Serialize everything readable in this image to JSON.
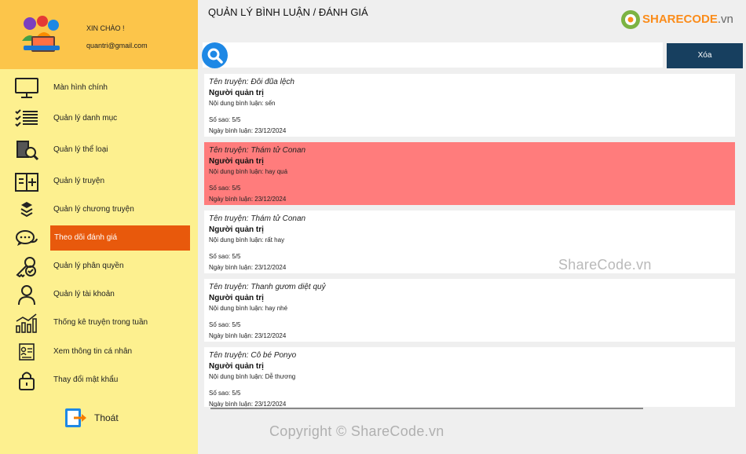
{
  "sidebar": {
    "greeting": "XIN CHÀO !",
    "email": "quantri@gmail.com",
    "items": [
      {
        "label": "Màn hình chính",
        "icon": "monitor-icon"
      },
      {
        "label": "Quản lý danh mục",
        "icon": "checklist-icon"
      },
      {
        "label": "Quản lý thể loại",
        "icon": "book-search-icon"
      },
      {
        "label": "Quản lý truyện",
        "icon": "book-add-icon"
      },
      {
        "label": "Quản lý chương truyện",
        "icon": "layers-icon"
      },
      {
        "label": "Theo dõi đánh giá",
        "icon": "chat-icon",
        "active": true
      },
      {
        "label": "Quản lý phân quyền",
        "icon": "key-user-icon"
      },
      {
        "label": "Quản lý tài khoản",
        "icon": "user-icon"
      },
      {
        "label": "Thống kê truyện trong tuần",
        "icon": "bar-chart-icon"
      },
      {
        "label": "Xem thông tin cá nhân",
        "icon": "id-card-icon"
      },
      {
        "label": "Thay đổi mật khẩu",
        "icon": "lock-icon"
      }
    ],
    "logout_label": "Thoát"
  },
  "header": {
    "title": "QUẢN LÝ BÌNH LUẬN / ĐÁNH GIÁ",
    "brand_main": "SHARECODE",
    "brand_suffix": ".vn"
  },
  "search": {
    "value": "",
    "placeholder": ""
  },
  "toolbar": {
    "delete_label": "Xóa"
  },
  "comments": [
    {
      "story": "Tên truyện: Đôi đũa lệch",
      "user": "Người quản trị",
      "content": "Nội dung bình luận: sến",
      "stars": "Số sao: 5/5",
      "date": "Ngày bình luận: 23/12/2024",
      "selected": false
    },
    {
      "story": "Tên truyện: Thám tử Conan",
      "user": "Người quản trị",
      "content": "Nội dung bình luận: hay quá",
      "stars": "Số sao: 5/5",
      "date": "Ngày bình luận: 23/12/2024",
      "selected": true
    },
    {
      "story": "Tên truyện: Thám tử Conan",
      "user": "Người quản trị",
      "content": "Nội dung bình luận: rất hay",
      "stars": "Số sao: 5/5",
      "date": "Ngày bình luận: 23/12/2024",
      "selected": false
    },
    {
      "story": "Tên truyện: Thanh gươm diệt quỷ",
      "user": "Người quản trị",
      "content": "Nội dung bình luận: hay nhé",
      "stars": "Số sao: 5/5",
      "date": "Ngày bình luận: 23/12/2024",
      "selected": false
    },
    {
      "story": "Tên truyện: Cô bé Ponyo",
      "user": "Người quản trị",
      "content": "Nội dung bình luận: Dễ thương",
      "stars": "Số sao: 5/5",
      "date": "Ngày bình luận: 23/12/2024",
      "selected": false
    }
  ],
  "watermarks": {
    "middle": "ShareCode.vn",
    "bottom": "Copyright © ShareCode.vn"
  },
  "colors": {
    "sidebar_bg": "#fdf08f",
    "header_bg": "#fcc54a",
    "active_item": "#e8590c",
    "selected_row": "#ff7c7c",
    "delete_button": "#173f5f",
    "search_button": "#1e88e5"
  }
}
